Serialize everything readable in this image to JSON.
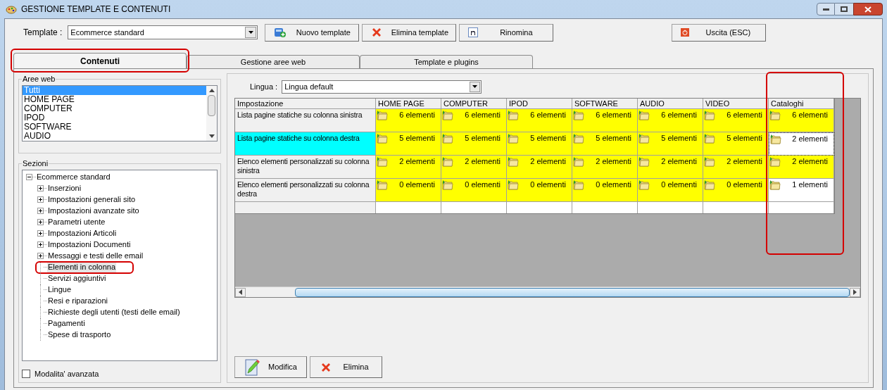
{
  "window": {
    "title": "GESTIONE TEMPLATE E CONTENUTI"
  },
  "toolbar": {
    "template_label": "Template :",
    "template_value": "Ecommerce standard",
    "buttons": [
      {
        "kind": "new",
        "label": "Nuovo template"
      },
      {
        "kind": "delete",
        "label": "Elimina template"
      },
      {
        "kind": "rename",
        "label": "Rinomina"
      },
      {
        "kind": "exit",
        "label": "Uscita (ESC)"
      }
    ]
  },
  "tabs": [
    {
      "label": "Contenuti",
      "selected": true,
      "highlighted": true
    },
    {
      "label": "Gestione aree web",
      "selected": false,
      "highlighted": false
    },
    {
      "label": "Template e plugins",
      "selected": false,
      "highlighted": false
    }
  ],
  "aree_web": {
    "title": "Aree web",
    "items": [
      {
        "label": "Tutti",
        "selected": true
      },
      {
        "label": "HOME PAGE",
        "selected": false
      },
      {
        "label": "COMPUTER",
        "selected": false
      },
      {
        "label": "IPOD",
        "selected": false
      },
      {
        "label": "SOFTWARE",
        "selected": false
      },
      {
        "label": "AUDIO",
        "selected": false
      }
    ]
  },
  "sezioni": {
    "title": "Sezioni",
    "tree": [
      {
        "label": "Ecommerce standard",
        "kind": "folder",
        "expanded": true,
        "selected": false,
        "highlighted": false,
        "children": [
          {
            "label": "Inserzioni",
            "kind": "folder",
            "expanded": false,
            "selected": false,
            "highlighted": false
          },
          {
            "label": "Impostazioni generali sito",
            "kind": "folder",
            "expanded": false,
            "selected": false,
            "highlighted": false
          },
          {
            "label": "Impostazioni avanzate sito",
            "kind": "folder",
            "expanded": false,
            "selected": false,
            "highlighted": false
          },
          {
            "label": "Parametri utente",
            "kind": "folder",
            "expanded": false,
            "selected": false,
            "highlighted": false
          },
          {
            "label": "Impostazioni Articoli",
            "kind": "folder",
            "expanded": false,
            "selected": false,
            "highlighted": false
          },
          {
            "label": "Impostazioni Documenti",
            "kind": "folder",
            "expanded": false,
            "selected": false,
            "highlighted": false
          },
          {
            "label": "Messaggi e testi delle email",
            "kind": "folder",
            "expanded": false,
            "selected": false,
            "highlighted": false
          },
          {
            "label": "Elementi in colonna",
            "kind": "leaf",
            "selected": true,
            "highlighted": true
          },
          {
            "label": "Servizi aggiuntivi",
            "kind": "leaf",
            "selected": false,
            "highlighted": false
          },
          {
            "label": "Lingue",
            "kind": "leaf",
            "selected": false,
            "highlighted": false
          },
          {
            "label": "Resi e riparazioni",
            "kind": "leaf",
            "selected": false,
            "highlighted": false
          },
          {
            "label": "Richieste degli utenti (testi delle email)",
            "kind": "leaf",
            "selected": false,
            "highlighted": false
          },
          {
            "label": "Pagamenti",
            "kind": "leaf",
            "selected": false,
            "highlighted": false
          },
          {
            "label": "Spese di trasporto",
            "kind": "leaf",
            "selected": false,
            "highlighted": false
          }
        ]
      }
    ]
  },
  "advanced_mode": {
    "label": "Modalita' avanzata",
    "checked": false
  },
  "lingua": {
    "label": "Lingua :",
    "value": "Lingua default"
  },
  "table": {
    "columns": [
      {
        "label": "Impostazione",
        "highlighted": false
      },
      {
        "label": "HOME PAGE",
        "highlighted": false
      },
      {
        "label": "COMPUTER",
        "highlighted": false
      },
      {
        "label": "IPOD",
        "highlighted": false
      },
      {
        "label": "SOFTWARE",
        "highlighted": false
      },
      {
        "label": "AUDIO",
        "highlighted": false
      },
      {
        "label": "VIDEO",
        "highlighted": false
      },
      {
        "label": "Cataloghi",
        "highlighted": true
      }
    ],
    "rows": [
      {
        "selected": false,
        "cells": [
          {
            "text": "Lista pagine statiche su colonna sinistra"
          },
          {
            "text": "6 elementi",
            "color": "#ffff00",
            "focused": false
          },
          {
            "text": "6 elementi",
            "color": "#ffff00",
            "focused": false
          },
          {
            "text": "6 elementi",
            "color": "#ffff00",
            "focused": false
          },
          {
            "text": "6 elementi",
            "color": "#ffff00",
            "focused": false
          },
          {
            "text": "6 elementi",
            "color": "#ffff00",
            "focused": false
          },
          {
            "text": "6 elementi",
            "color": "#ffff00",
            "focused": false
          },
          {
            "text": "6 elementi",
            "color": "#ffff00",
            "focused": false
          }
        ]
      },
      {
        "selected": true,
        "cells": [
          {
            "text": "Lista pagine statiche su colonna destra"
          },
          {
            "text": "5 elementi",
            "color": "#ffff00",
            "focused": false
          },
          {
            "text": "5 elementi",
            "color": "#ffff00",
            "focused": false
          },
          {
            "text": "5 elementi",
            "color": "#ffff00",
            "focused": false
          },
          {
            "text": "5 elementi",
            "color": "#ffff00",
            "focused": false
          },
          {
            "text": "5 elementi",
            "color": "#ffff00",
            "focused": false
          },
          {
            "text": "5 elementi",
            "color": "#ffff00",
            "focused": false
          },
          {
            "text": "2 elementi",
            "color": "#ffffff",
            "focused": true
          }
        ]
      },
      {
        "selected": false,
        "cells": [
          {
            "text": "Elenco elementi personalizzati su colonna sinistra"
          },
          {
            "text": "2 elementi",
            "color": "#ffff00",
            "focused": false
          },
          {
            "text": "2 elementi",
            "color": "#ffff00",
            "focused": false
          },
          {
            "text": "2 elementi",
            "color": "#ffff00",
            "focused": false
          },
          {
            "text": "2 elementi",
            "color": "#ffff00",
            "focused": false
          },
          {
            "text": "2 elementi",
            "color": "#ffff00",
            "focused": false
          },
          {
            "text": "2 elementi",
            "color": "#ffff00",
            "focused": false
          },
          {
            "text": "2 elementi",
            "color": "#ffff00",
            "focused": false
          }
        ]
      },
      {
        "selected": false,
        "cells": [
          {
            "text": "Elenco elementi personalizzati su colonna destra"
          },
          {
            "text": "0 elementi",
            "color": "#ffff00",
            "focused": false
          },
          {
            "text": "0 elementi",
            "color": "#ffff00",
            "focused": false
          },
          {
            "text": "0 elementi",
            "color": "#ffff00",
            "focused": false
          },
          {
            "text": "0 elementi",
            "color": "#ffff00",
            "focused": false
          },
          {
            "text": "0 elementi",
            "color": "#ffff00",
            "focused": false
          },
          {
            "text": "0 elementi",
            "color": "#ffff00",
            "focused": false
          },
          {
            "text": "1 elementi",
            "color": "#ffffff",
            "focused": false
          }
        ]
      }
    ]
  },
  "bottom_buttons": [
    {
      "kind": "edit",
      "label": "Modifica"
    },
    {
      "kind": "delete",
      "label": "Elimina"
    }
  ]
}
